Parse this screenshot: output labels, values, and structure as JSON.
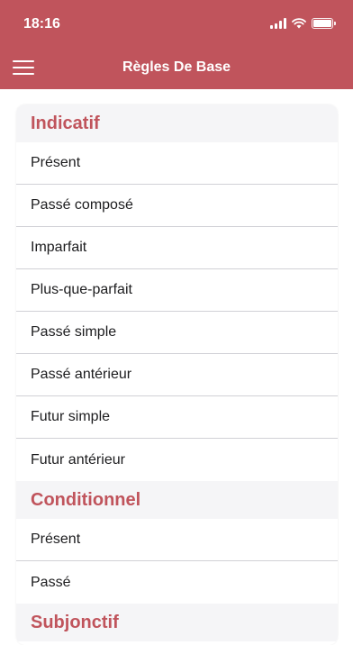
{
  "status_bar": {
    "time": "18:16"
  },
  "nav": {
    "title": "Règles De Base",
    "menu_icon": "hamburger-icon"
  },
  "colors": {
    "accent": "#c0545c",
    "section_bg": "#f5f5f7"
  },
  "sections": [
    {
      "title": "Indicatif",
      "items": [
        "Présent",
        "Passé composé",
        "Imparfait",
        "Plus-que-parfait",
        "Passé simple",
        "Passé antérieur",
        "Futur simple",
        "Futur antérieur"
      ]
    },
    {
      "title": "Conditionnel",
      "items": [
        "Présent",
        "Passé"
      ]
    },
    {
      "title": "Subjonctif",
      "items": []
    }
  ]
}
